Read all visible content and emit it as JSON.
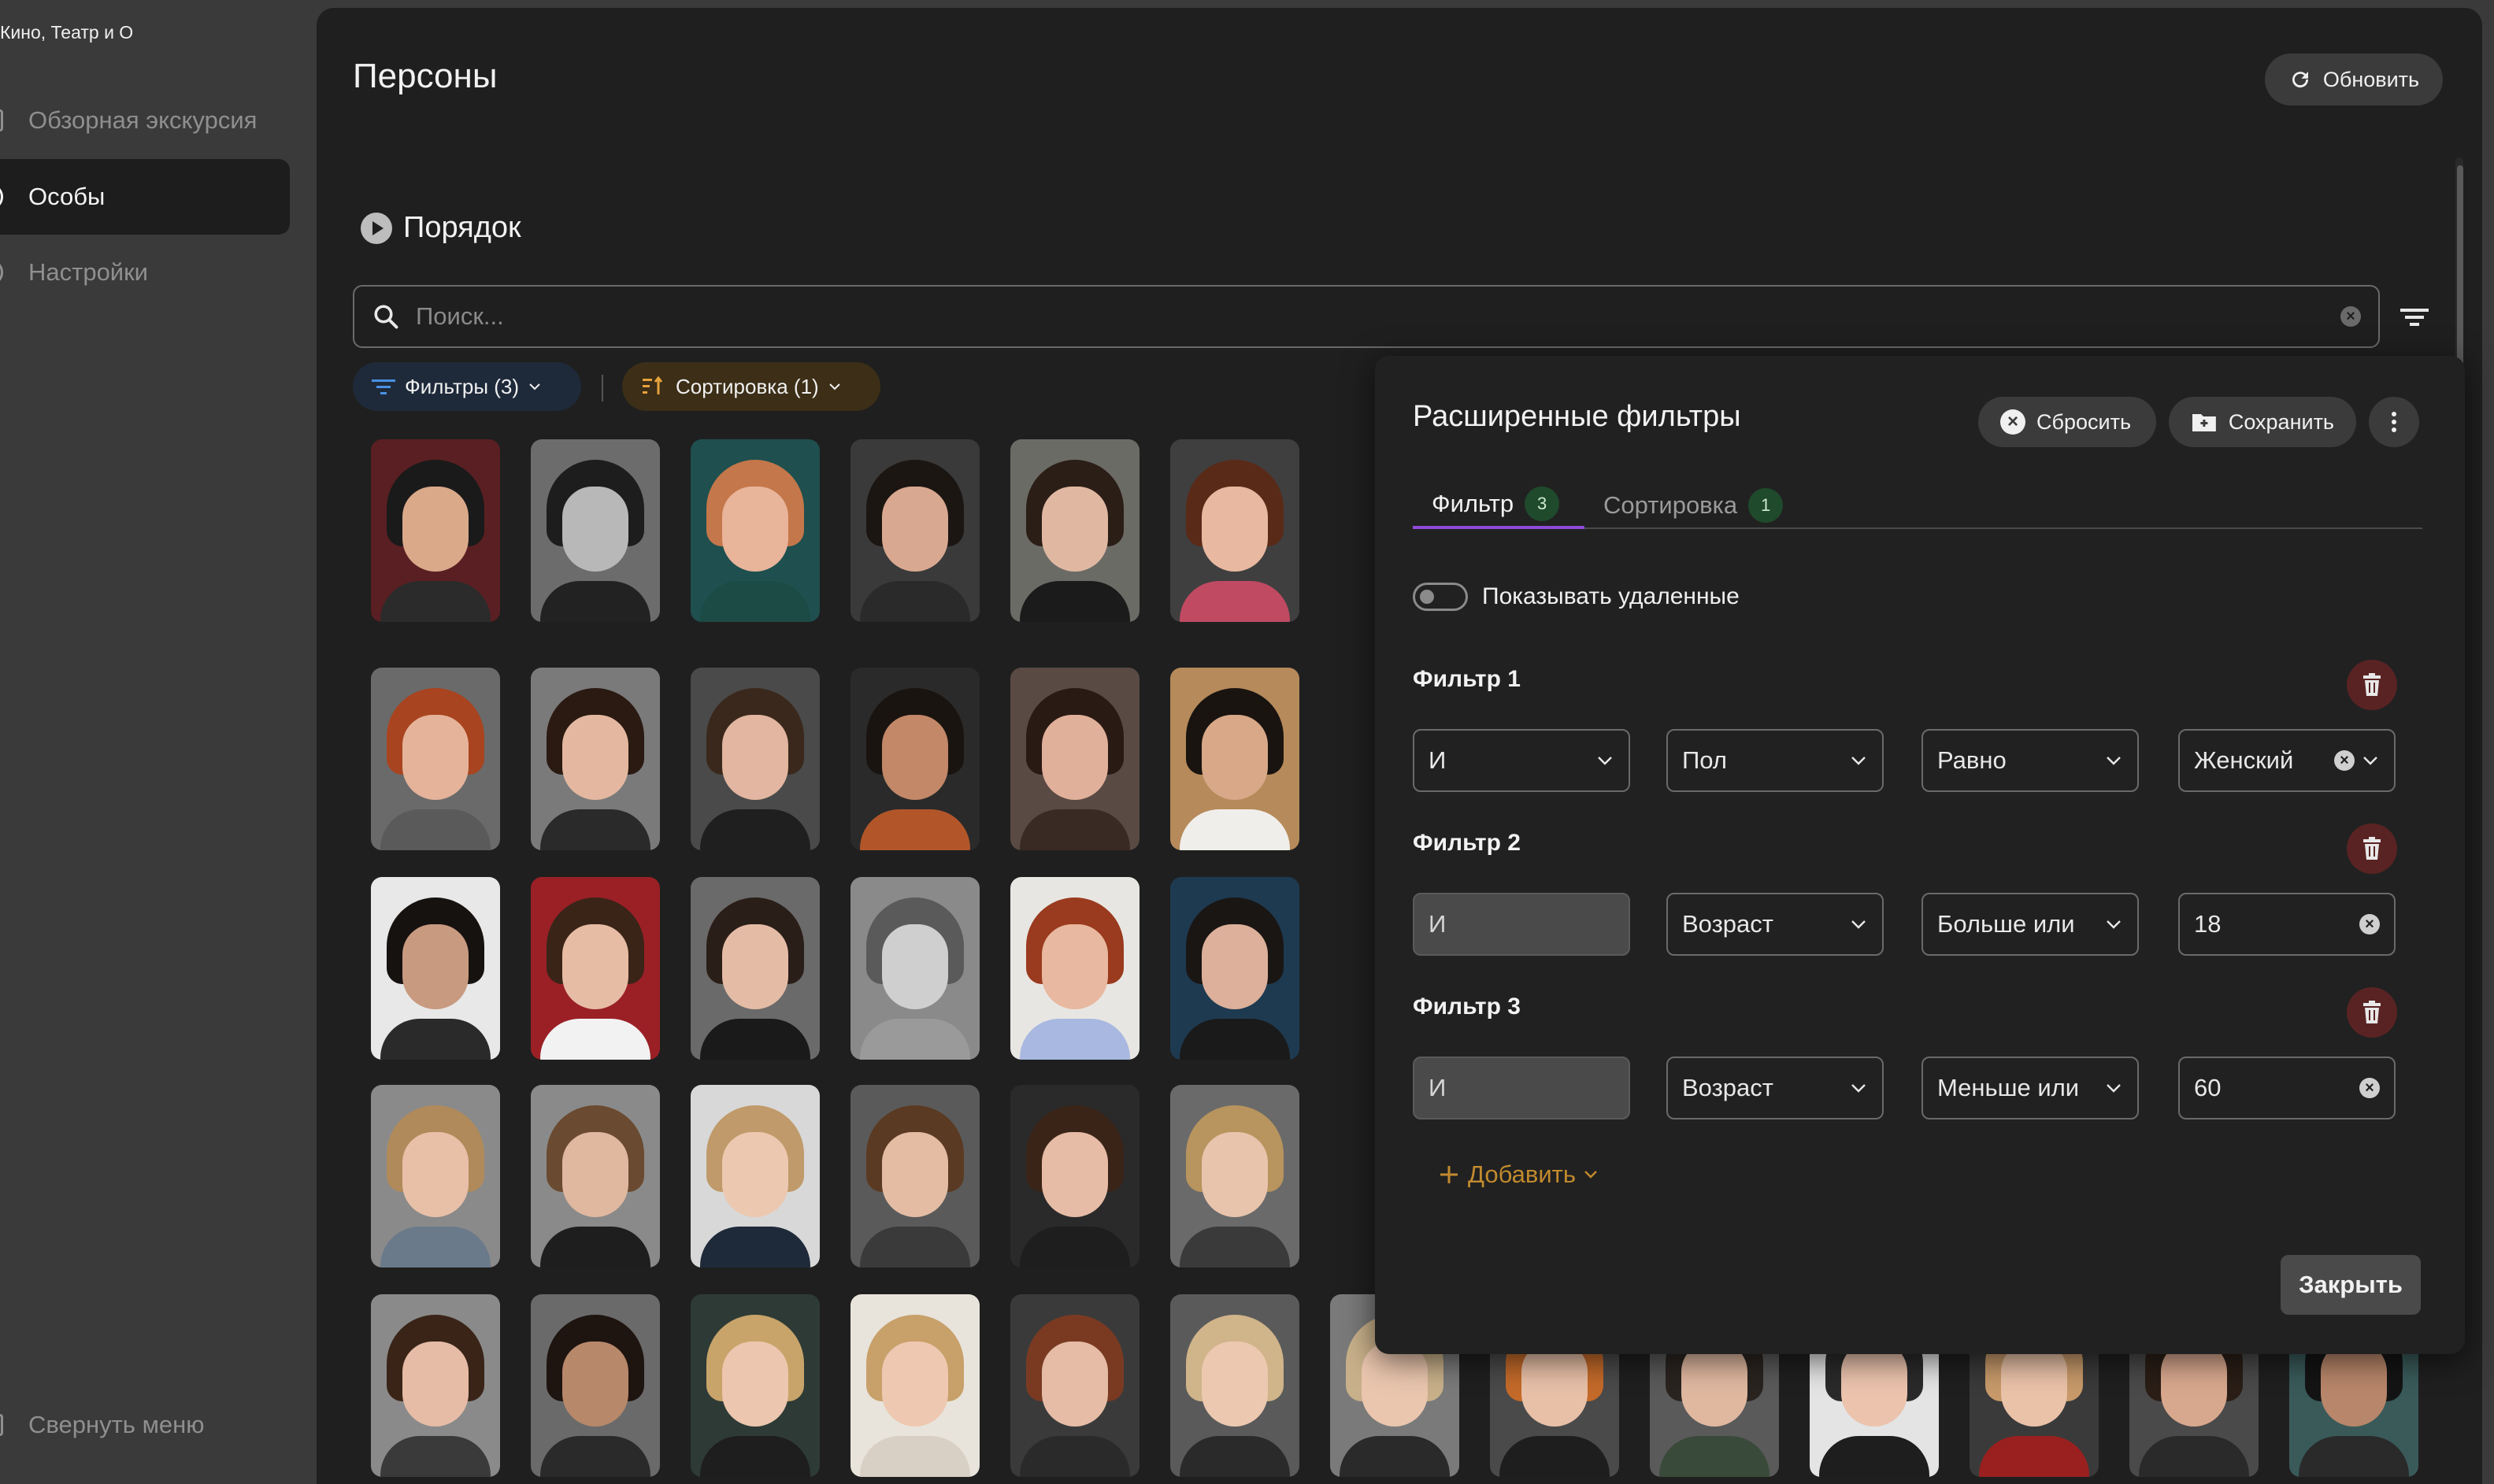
{
  "app": {
    "brand": "Кино, Театр и О"
  },
  "sidebar": {
    "items": [
      {
        "label": "Обзорная экскурсия",
        "icon": "tour-icon",
        "active": false
      },
      {
        "label": "Особы",
        "icon": "person-icon",
        "active": true
      },
      {
        "label": "Настройки",
        "icon": "settings-icon",
        "active": false
      }
    ],
    "collapse_label": "Свернуть меню"
  },
  "header": {
    "title": "Персоны",
    "refresh_label": "Обновить"
  },
  "order": {
    "label": "Порядок"
  },
  "search": {
    "placeholder": "Поиск..."
  },
  "chips": {
    "filters_label": "Фильтры (3)",
    "sort_label": "Сортировка (1)"
  },
  "grid": {
    "rows": [
      [
        {
          "bg": "#5a1f22",
          "hair": "#1a1a1a",
          "skin": "#d9a98a",
          "cloth": "#2b2b2b"
        },
        {
          "bg": "#6c6c6c",
          "hair": "#1d1d1d",
          "skin": "#b8b8b8",
          "cloth": "#222222"
        },
        {
          "bg": "#1f4f4f",
          "hair": "#c4774a",
          "skin": "#e8b49a",
          "cloth": "#1c4a44"
        },
        {
          "bg": "#3a3a3a",
          "hair": "#1c1612",
          "skin": "#d8a890",
          "cloth": "#2a2a2a"
        },
        {
          "bg": "#6b6b66",
          "hair": "#2b1e16",
          "skin": "#e0b8a2",
          "cloth": "#1b1b1b"
        },
        {
          "bg": "#3f3f3f",
          "hair": "#5a2a18",
          "skin": "#e8b8a0",
          "cloth": "#c04a62"
        }
      ],
      [
        {
          "bg": "#6a6a6a",
          "hair": "#a8441f",
          "skin": "#e4b39a",
          "cloth": "#5a5a5a"
        },
        {
          "bg": "#7a7a7a",
          "hair": "#2a1a12",
          "skin": "#e4b8a0",
          "cloth": "#2a2a2a"
        },
        {
          "bg": "#4a4a4a",
          "hair": "#3a281c",
          "skin": "#e2b6a0",
          "cloth": "#1f1f1f"
        },
        {
          "bg": "#2a2a2a",
          "hair": "#1a1410",
          "skin": "#c28868",
          "cloth": "#b2562a"
        },
        {
          "bg": "#5a4a44",
          "hair": "#2a1a14",
          "skin": "#e0b09a",
          "cloth": "#3a2a24"
        },
        {
          "bg": "#b68a5a",
          "hair": "#1a1410",
          "skin": "#d8a888",
          "cloth": "#f0eeea"
        }
      ],
      [
        {
          "bg": "#e8e8e8",
          "hair": "#161210",
          "skin": "#c89a80",
          "cloth": "#2a2a2a"
        },
        {
          "bg": "#9a2026",
          "hair": "#3a2418",
          "skin": "#e6bca4",
          "cloth": "#f2f2f2"
        },
        {
          "bg": "#6a6a6a",
          "hair": "#2a1e18",
          "skin": "#e4bca6",
          "cloth": "#1a1a1a"
        },
        {
          "bg": "#8a8a8a",
          "hair": "#5a5a5a",
          "skin": "#cfcfcf",
          "cloth": "#9a9a9a"
        },
        {
          "bg": "#e8e6e2",
          "hair": "#9a3a1e",
          "skin": "#e8b8a0",
          "cloth": "#a8b8e0"
        },
        {
          "bg": "#1e3a50",
          "hair": "#1a1614",
          "skin": "#dcb09a",
          "cloth": "#1a1a1a"
        }
      ],
      [
        {
          "bg": "#8a8a8a",
          "hair": "#b08a5a",
          "skin": "#e8c0a8",
          "cloth": "#6a7a8a"
        },
        {
          "bg": "#8a8a8a",
          "hair": "#6a4a30",
          "skin": "#e0b8a0",
          "cloth": "#1e1e1e"
        },
        {
          "bg": "#d8d8d8",
          "hair": "#c09a6a",
          "skin": "#ecc8b0",
          "cloth": "#1e2a3a"
        },
        {
          "bg": "#5a5a5a",
          "hair": "#5a3a22",
          "skin": "#e4bca4",
          "cloth": "#3a3a3a"
        },
        {
          "bg": "#2a2a2a",
          "hair": "#3a2418",
          "skin": "#e6bca6",
          "cloth": "#1e1e1e"
        },
        {
          "bg": "#6a6a6a",
          "hair": "#b8945e",
          "skin": "#e8c4ac",
          "cloth": "#3a3a3a"
        }
      ],
      [
        {
          "bg": "#8a8a8a",
          "hair": "#3a2418",
          "skin": "#e6bca6",
          "cloth": "#3a3a3a"
        },
        {
          "bg": "#6a6a6a",
          "hair": "#1e1410",
          "skin": "#b8886a",
          "cloth": "#2a2a2a"
        },
        {
          "bg": "#2e3a36",
          "hair": "#c8a46a",
          "skin": "#ecc6ae",
          "cloth": "#1e1e1e"
        },
        {
          "bg": "#e8e4dc",
          "hair": "#c8a06a",
          "skin": "#eec8b0",
          "cloth": "#d8d0c4"
        },
        {
          "bg": "#3a3a3a",
          "hair": "#7a3a22",
          "skin": "#e6bca6",
          "cloth": "#2a2a2a"
        },
        {
          "bg": "#5a5a5a",
          "hair": "#d0b48a",
          "skin": "#ecc8b0",
          "cloth": "#2a2a2a"
        },
        {
          "bg": "#7a7a7a",
          "hair": "#c8b08a",
          "skin": "#eac6ae",
          "cloth": "#2a2a2a"
        },
        {
          "bg": "#4a4a4a",
          "hair": "#c46a2a",
          "skin": "#e8c0a8",
          "cloth": "#1e1e1e"
        },
        {
          "bg": "#5a5a5a",
          "hair": "#2a2420",
          "skin": "#e0b8a0",
          "cloth": "#3a4a3a"
        },
        {
          "bg": "#e4e4e4",
          "hair": "#2a2a2a",
          "skin": "#ecc4ae",
          "cloth": "#1e1e1e"
        },
        {
          "bg": "#3a3a3a",
          "hair": "#c89a6a",
          "skin": "#eac2a8",
          "cloth": "#9a2020"
        },
        {
          "bg": "#4a4a4a",
          "hair": "#2a1e16",
          "skin": "#d8a88e",
          "cloth": "#2a2a2a"
        },
        {
          "bg": "#3a5a5a",
          "hair": "#141414",
          "skin": "#b8866a",
          "cloth": "#2a2a2a"
        }
      ]
    ]
  },
  "panel": {
    "title": "Расширенные фильтры",
    "reset_label": "Сбросить",
    "save_label": "Сохранить",
    "tabs": [
      {
        "label": "Фильтр",
        "badge": "3"
      },
      {
        "label": "Сортировка",
        "badge": "1"
      }
    ],
    "show_deleted_label": "Показывать удаленные",
    "filters": [
      {
        "title": "Фильтр 1",
        "logic": "И",
        "field": "Пол",
        "operator": "Равно",
        "value": "Женский"
      },
      {
        "title": "Фильтр 2",
        "logic": "И",
        "field": "Возраст",
        "operator": "Больше или",
        "value": "18"
      },
      {
        "title": "Фильтр 3",
        "logic": "И",
        "field": "Возраст",
        "operator": "Меньше или",
        "value": "60"
      }
    ],
    "add_label": "Добавить",
    "close_label": "Закрыть"
  },
  "colors": {
    "accent_purple": "#8f4ad8",
    "add_orange": "#c28a2e",
    "trash_red": "#5a2323",
    "badge_green": "#1f4a2c"
  }
}
